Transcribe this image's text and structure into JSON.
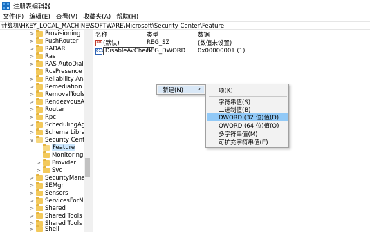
{
  "window": {
    "title": "注册表编辑器"
  },
  "menu": [
    "文件(F)",
    "编辑(E)",
    "查看(V)",
    "收藏夹(A)",
    "帮助(H)"
  ],
  "address": "计算机\\HKEY_LOCAL_MACHINE\\SOFTWARE\\Microsoft\\Security Center\\Feature",
  "tree": {
    "items": [
      {
        "label": "Provisioning",
        "expander": ">"
      },
      {
        "label": "PushRouter",
        "expander": ">"
      },
      {
        "label": "RADAR",
        "expander": ">"
      },
      {
        "label": "Ras",
        "expander": ">"
      },
      {
        "label": "RAS AutoDial",
        "expander": ">"
      },
      {
        "label": "RcsPresence",
        "expander": ""
      },
      {
        "label": "Reliability Analys",
        "expander": ">"
      },
      {
        "label": "Remediation",
        "expander": ">"
      },
      {
        "label": "RemovalTools",
        "expander": ">"
      },
      {
        "label": "RendezvousApp",
        "expander": ">"
      },
      {
        "label": "Router",
        "expander": ">"
      },
      {
        "label": "Rpc",
        "expander": ">"
      },
      {
        "label": "SchedulingAgen",
        "expander": ">"
      },
      {
        "label": "Schema Library",
        "expander": ">"
      },
      {
        "label": "Security Center",
        "expander": "v"
      },
      {
        "label": "Feature",
        "expander": ""
      },
      {
        "label": "Monitoring",
        "expander": ""
      },
      {
        "label": "Provider",
        "expander": ">"
      },
      {
        "label": "Svc",
        "expander": ">"
      },
      {
        "label": "SecurityManage",
        "expander": ">"
      },
      {
        "label": "SEMgr",
        "expander": ">"
      },
      {
        "label": "Sensors",
        "expander": ">"
      },
      {
        "label": "ServicesForNFS",
        "expander": ">"
      },
      {
        "label": "Shared",
        "expander": ">"
      },
      {
        "label": "Shared Tools",
        "expander": ">"
      },
      {
        "label": "Shared Tools Lo",
        "expander": ">"
      },
      {
        "label": "Shell",
        "expander": ">"
      }
    ]
  },
  "columns": {
    "name": "名称",
    "type": "类型",
    "data": "数据"
  },
  "values": [
    {
      "icon": "ab",
      "name": "(默认)",
      "type": "REG_SZ",
      "data": "(数值未设置)"
    },
    {
      "icon": "011",
      "name": "DisableAvCheck",
      "type": "REG_DWORD",
      "data": "0x00000001 (1)"
    }
  ],
  "context_menu": {
    "new_label": "新建(N)",
    "arrow": "›",
    "submenu": [
      "项(K)",
      "字符串值(S)",
      "二进制值(B)",
      "DWORD (32 位)值(D)",
      "QWORD (64 位)值(Q)",
      "多字符串值(M)",
      "可扩充字符串值(E)"
    ]
  }
}
